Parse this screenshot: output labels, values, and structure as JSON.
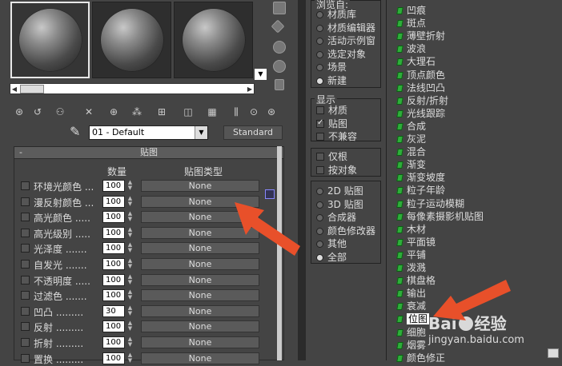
{
  "left": {
    "mat_name": "01 - Default",
    "mat_type": "Standard",
    "rollout_title": "贴图",
    "col_amount": "数量",
    "col_maptype": "贴图类型",
    "rows": [
      {
        "label": "环境光颜色 ...",
        "value": "100",
        "map": "None"
      },
      {
        "label": "漫反射颜色 ...",
        "value": "100",
        "map": "None"
      },
      {
        "label": "高光颜色 .....",
        "value": "100",
        "map": "None"
      },
      {
        "label": "高光级别 .....",
        "value": "100",
        "map": "None"
      },
      {
        "label": "光泽度 .......",
        "value": "100",
        "map": "None"
      },
      {
        "label": "自发光 .......",
        "value": "100",
        "map": "None"
      },
      {
        "label": "不透明度 .....",
        "value": "100",
        "map": "None"
      },
      {
        "label": "过滤色 .......",
        "value": "100",
        "map": "None"
      },
      {
        "label": "凹凸 .........",
        "value": "30",
        "map": "None"
      },
      {
        "label": "反射 .........",
        "value": "100",
        "map": "None"
      },
      {
        "label": "折射 .........",
        "value": "100",
        "map": "None"
      },
      {
        "label": "置换 .........",
        "value": "100",
        "map": "None"
      }
    ]
  },
  "browse": {
    "title": "浏览自:",
    "options": [
      "材质库",
      "材质编辑器",
      "活动示例窗",
      "选定对象",
      "场景",
      "新建"
    ],
    "selected": 5
  },
  "show": {
    "title": "显示",
    "items": [
      {
        "label": "材质",
        "checked": false
      },
      {
        "label": "贴图",
        "checked": true
      },
      {
        "label": "不兼容",
        "checked": false
      }
    ]
  },
  "extra": {
    "items": [
      {
        "label": "仅根",
        "checked": false
      },
      {
        "label": "按对象",
        "checked": false
      }
    ]
  },
  "filter": {
    "options": [
      "2D 贴图",
      "3D 贴图",
      "合成器",
      "颜色修改器",
      "其他",
      "全部"
    ],
    "selected": 5
  },
  "maps": {
    "items": [
      "凹痕",
      "斑点",
      "薄壁折射",
      "波浪",
      "大理石",
      "顶点颜色",
      "法线凹凸",
      "反射/折射",
      "光线跟踪",
      "合成",
      "灰泥",
      "混合",
      "渐变",
      "渐变坡度",
      "粒子年龄",
      "粒子运动模糊",
      "每像素摄影机贴图",
      "木材",
      "平面镜",
      "平铺",
      "泼溅",
      "棋盘格",
      "输出",
      "衰减",
      "位图",
      "细胞",
      "烟雾",
      "颜色修正"
    ],
    "selected": 24
  },
  "watermark": {
    "brand": "Bai",
    "brand2": "经验",
    "url": "jingyan.baidu.com"
  },
  "colors": {
    "accent_arrow": "#e8502a",
    "map_icon": "#2eae3a"
  }
}
